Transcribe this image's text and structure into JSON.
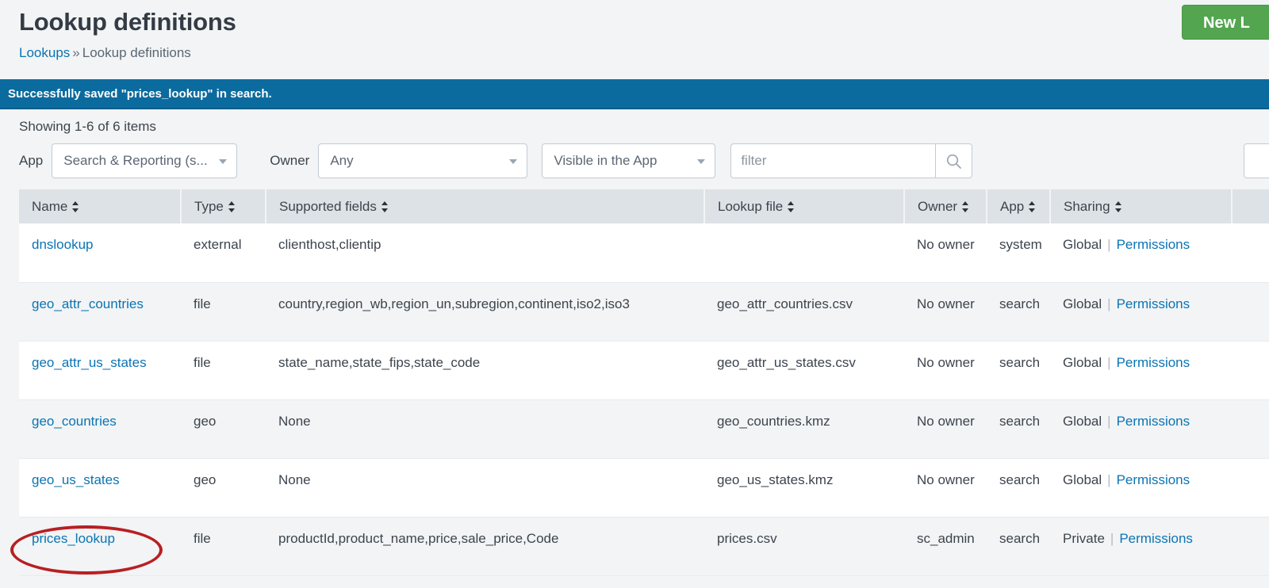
{
  "header": {
    "title": "Lookup definitions",
    "breadcrumb": {
      "parent": "Lookups",
      "separator": "»",
      "current": "Lookup definitions"
    },
    "new_button_label": "New L"
  },
  "banner": {
    "message": "Successfully saved \"prices_lookup\" in search.",
    "color": "#0c6b9e"
  },
  "controls": {
    "showing": "Showing 1-6 of 6 items",
    "app_label": "App",
    "app_value": "Search & Reporting (s...",
    "owner_label": "Owner",
    "owner_value": "Any",
    "visibility_value": "Visible in the App",
    "filter_placeholder": "filter",
    "filter_value": "",
    "search_icon": "search-icon"
  },
  "table": {
    "columns": [
      "Name",
      "Type",
      "Supported fields",
      "Lookup file",
      "Owner",
      "App",
      "Sharing"
    ],
    "permissions_label": "Permissions",
    "rows": [
      {
        "name": "dnslookup",
        "type": "external",
        "fields": "clienthost,clientip",
        "file": "",
        "owner": "No owner",
        "app": "system",
        "sharing": "Global"
      },
      {
        "name": "geo_attr_countries",
        "type": "file",
        "fields": "country,region_wb,region_un,subregion,continent,iso2,iso3",
        "file": "geo_attr_countries.csv",
        "owner": "No owner",
        "app": "search",
        "sharing": "Global"
      },
      {
        "name": "geo_attr_us_states",
        "type": "file",
        "fields": "state_name,state_fips,state_code",
        "file": "geo_attr_us_states.csv",
        "owner": "No owner",
        "app": "search",
        "sharing": "Global"
      },
      {
        "name": "geo_countries",
        "type": "geo",
        "fields": "None",
        "file": "geo_countries.kmz",
        "owner": "No owner",
        "app": "search",
        "sharing": "Global"
      },
      {
        "name": "geo_us_states",
        "type": "geo",
        "fields": "None",
        "file": "geo_us_states.kmz",
        "owner": "No owner",
        "app": "search",
        "sharing": "Global"
      },
      {
        "name": "prices_lookup",
        "type": "file",
        "fields": "productId,product_name,price,sale_price,Code",
        "file": "prices.csv",
        "owner": "sc_admin",
        "app": "search",
        "sharing": "Private"
      }
    ]
  },
  "annotation": {
    "shape": "ellipse",
    "target": "prices_lookup",
    "color": "#b81f22"
  }
}
